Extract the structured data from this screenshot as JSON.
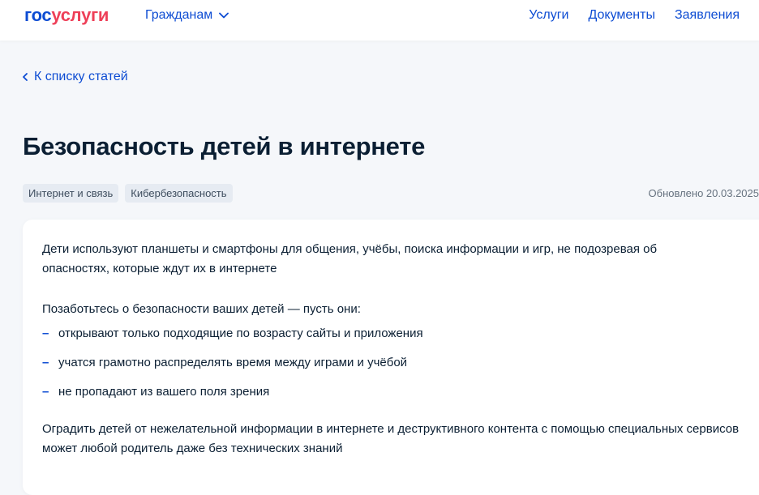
{
  "header": {
    "logo_part1": "гос",
    "logo_part2": "услуги",
    "audience_menu": "Гражданам",
    "links": [
      "Услуги",
      "Документы",
      "Заявления"
    ]
  },
  "back_link": "К списку статей",
  "title": "Безопасность детей в интернете",
  "tags": [
    "Интернет и связь",
    "Кибербезопасность"
  ],
  "updated": "Обновлено 20.03.2025",
  "article": {
    "intro": "Дети используют планшеты и смартфоны для общения, учёбы, поиска информации и игр, не подозревая об опасностях, которые ждут их в интернете",
    "lead": "Позаботьтесь о безопасности ваших детей — пусть они:",
    "bullet_marker": "–",
    "bullets": [
      "открывают только подходящие по возрасту сайты и приложения",
      "учатся грамотно распределять время между играми и учёбой",
      "не пропадают из вашего поля зрения"
    ],
    "outro": "Оградить детей от нежелательной информации в интернете и деструктивного контента с помощью специальных сервисов может любой родитель даже без технических знаний"
  },
  "colors": {
    "brand_blue": "#0d4cd3",
    "brand_red": "#ee3f58",
    "text": "#0b1f33",
    "background": "#f5f7fa"
  }
}
